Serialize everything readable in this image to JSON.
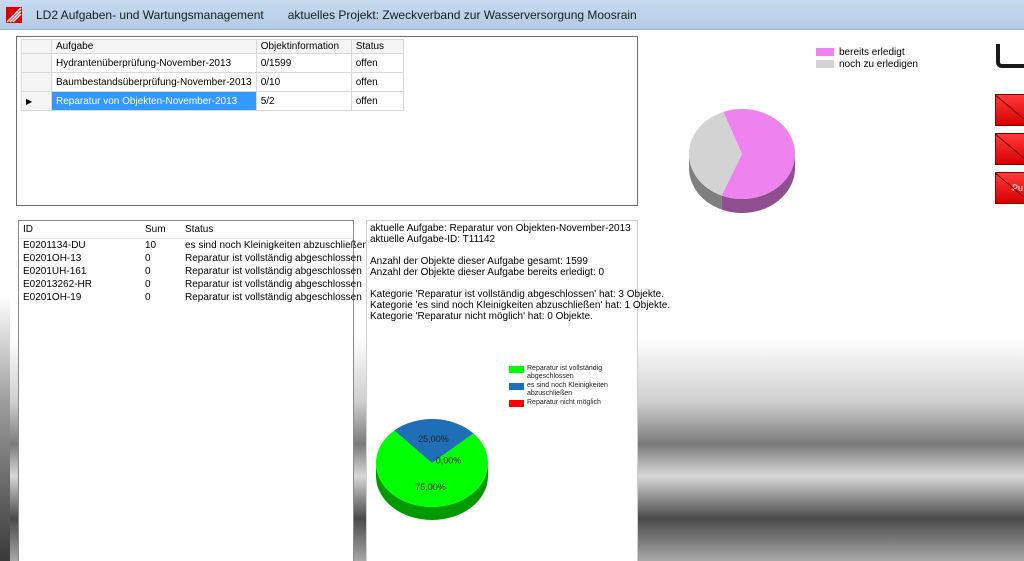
{
  "window": {
    "title": "LD2 Aufgaben- und Wartungsmanagement",
    "project": "aktuelles Projekt: Zweckverband zur Wasserversorgung Moosrain"
  },
  "tasks": {
    "columns": [
      "Aufgabe",
      "Objektinformation",
      "Status"
    ],
    "rows": [
      {
        "task": "Hydrantenüberprüfung-November-2013",
        "info": "0/1599",
        "status": "offen"
      },
      {
        "task": "Baumbestandsüberprüfung-November-2013",
        "info": "0/10",
        "status": "offen"
      },
      {
        "task": "Reparatur von Objekten-November-2013",
        "info": "5/2",
        "status": "offen"
      }
    ],
    "selected_index": 2
  },
  "objects": {
    "columns": [
      "ID",
      "Sum",
      "Status"
    ],
    "rows": [
      {
        "id": "E0201134-DU",
        "sum": "10",
        "status": "es sind noch Kleinigkeiten abzuschließen"
      },
      {
        "id": "E0201OH-13",
        "sum": "0",
        "status": "Reparatur ist vollständig abgeschlossen"
      },
      {
        "id": "E0201UH-161",
        "sum": "0",
        "status": "Reparatur ist vollständig abgeschlossen"
      },
      {
        "id": "E02013262-HR",
        "sum": "0",
        "status": "Reparatur ist vollständig abgeschlossen"
      },
      {
        "id": "E0201OH-19",
        "sum": "0",
        "status": "Reparatur ist vollständig abgeschlossen"
      }
    ]
  },
  "info": {
    "lines": [
      "aktuelle Aufgabe: Reparatur von Objekten-November-2013",
      "aktuelle Aufgabe-ID: T11142",
      "",
      "Anzahl der Objekte dieser Aufgabe gesamt: 1599",
      "Anzahl der Objekte dieser Aufgabe bereits erledigt: 0",
      "",
      "Kategorie 'Reparatur ist vollständig abgeschlossen' hat: 3 Objekte.",
      "Kategorie 'es sind noch Kleinigkeiten abzuschließen' hat: 1 Objekte.",
      "Kategorie 'Reparatur nicht möglich' hat: 0 Objekte."
    ]
  },
  "chart_data": [
    {
      "type": "pie",
      "title": "",
      "series": [
        {
          "name": "bereits erledigt",
          "value": 62,
          "color": "#ee82ee"
        },
        {
          "name": "noch zu erledigen",
          "value": 38,
          "color": "#d3d3d3"
        }
      ],
      "legend": "top-right"
    },
    {
      "type": "pie",
      "title": "",
      "series": [
        {
          "name": "Reparatur ist vollständig abgeschlossen",
          "value": 75,
          "label": "75,00%",
          "color": "#00ff00"
        },
        {
          "name": "es sind noch Kleinigkeiten abzuschließen",
          "value": 25,
          "label": "25,00%",
          "color": "#1e6fb8"
        },
        {
          "name": "Reparatur nicht möglich",
          "value": 0,
          "label": "0,00%",
          "color": "#ff0000"
        }
      ],
      "legend": "top-right"
    }
  ],
  "right_buttons": [
    "",
    "",
    "Pu"
  ]
}
